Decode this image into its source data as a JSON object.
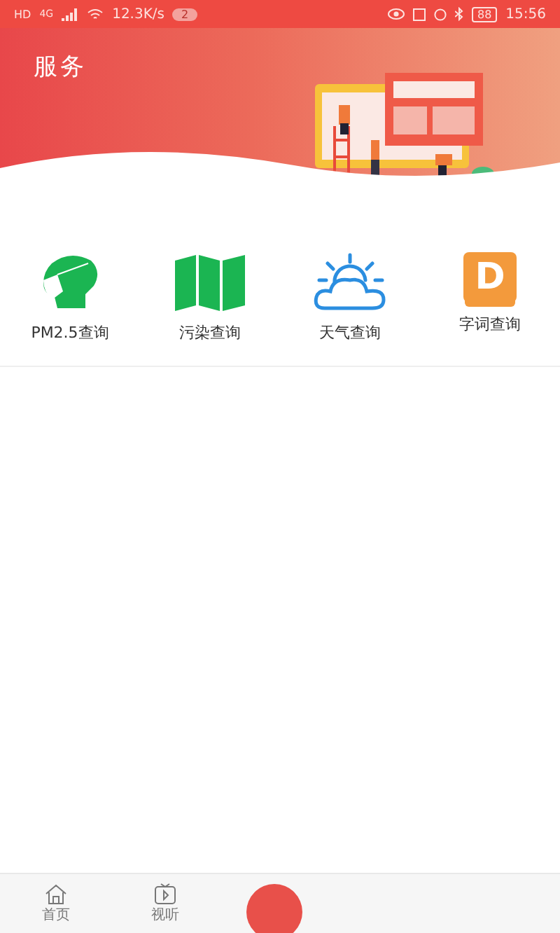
{
  "status_bar": {
    "hd": "HD",
    "network": "4G",
    "speed": "12.3K/s",
    "notification_count": "2",
    "battery": "88",
    "time": "15:56"
  },
  "header": {
    "title": "服务"
  },
  "services": [
    {
      "kind": "mask",
      "label": "PM2.5查询"
    },
    {
      "kind": "map",
      "label": "污染查询"
    },
    {
      "kind": "weather",
      "label": "天气查询"
    },
    {
      "kind": "dictionary",
      "label": "字词查询",
      "icon_letter": "D"
    }
  ],
  "bottom_nav": [
    {
      "kind": "home",
      "label": "首页",
      "selected": false
    },
    {
      "kind": "video",
      "label": "视听",
      "selected": false
    },
    {
      "kind": "center",
      "selected": true
    }
  ]
}
